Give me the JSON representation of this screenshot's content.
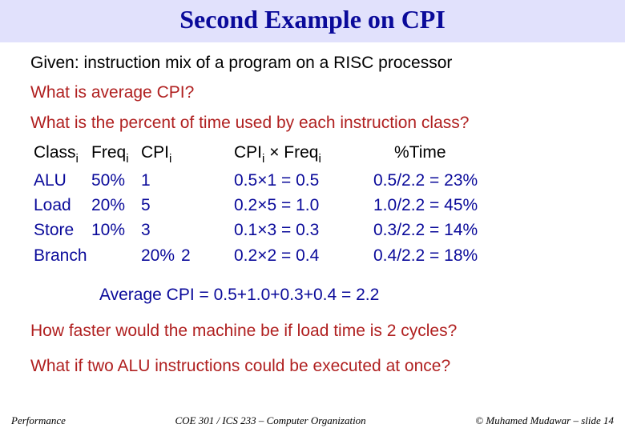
{
  "title": "Second Example on CPI",
  "given": "Given: instruction mix of a program on a RISC processor",
  "q1": "What is average CPI?",
  "q2": "What is the percent of time used by each instruction class?",
  "headers": {
    "class_pre": "Class",
    "class_sub": "i",
    "freq_pre": "Freq",
    "freq_sub": "i",
    "cpi_pre": "CPI",
    "cpi_sub": "i",
    "cpifreq_pre": "CPI",
    "cpifreq_sub1": "i",
    "cpifreq_mid": " × Freq",
    "cpifreq_sub2": "i",
    "time": "%Time"
  },
  "rows": [
    {
      "class": "ALU",
      "freq": "50%",
      "cpi": "1",
      "cpi2": "",
      "calc": "0.5×1 = 0.5",
      "time": "0.5/2.2 = 23%"
    },
    {
      "class": "Load",
      "freq": "20%",
      "cpi": "5",
      "cpi2": "",
      "calc": "0.2×5 = 1.0",
      "time": "1.0/2.2 = 45%"
    },
    {
      "class": "Store",
      "freq": "10%",
      "cpi": "3",
      "cpi2": "",
      "calc": "0.1×3 = 0.3",
      "time": "0.3/2.2 = 14%"
    },
    {
      "class": "Branch",
      "freq": "",
      "cpi": "20%",
      "cpi2": "2",
      "calc": "0.2×2 = 0.4",
      "time": "0.4/2.2 = 18%"
    }
  ],
  "avg": "Average CPI = 0.5+1.0+0.3+0.4 = 2.2",
  "q3": "How faster would the machine be if load time is 2 cycles?",
  "q4": "What if two ALU instructions could be executed at once?",
  "footer": {
    "left": "Performance",
    "center": "COE 301 / ICS 233 – Computer Organization",
    "right": "© Muhamed Mudawar – slide 14"
  },
  "chart_data": {
    "type": "table",
    "title": "Second Example on CPI",
    "columns": [
      "Class_i",
      "Freq_i",
      "CPI_i",
      "CPI_i × Freq_i",
      "%Time"
    ],
    "rows": [
      [
        "ALU",
        "50%",
        1,
        "0.5×1 = 0.5",
        "0.5/2.2 = 23%"
      ],
      [
        "Load",
        "20%",
        5,
        "0.2×5 = 1.0",
        "1.0/2.2 = 45%"
      ],
      [
        "Store",
        "10%",
        3,
        "0.1×3 = 0.3",
        "0.3/2.2 = 14%"
      ],
      [
        "Branch",
        "20%",
        2,
        "0.2×2 = 0.4",
        "0.4/2.2 = 18%"
      ]
    ],
    "summary": "Average CPI = 0.5+1.0+0.3+0.4 = 2.2"
  }
}
